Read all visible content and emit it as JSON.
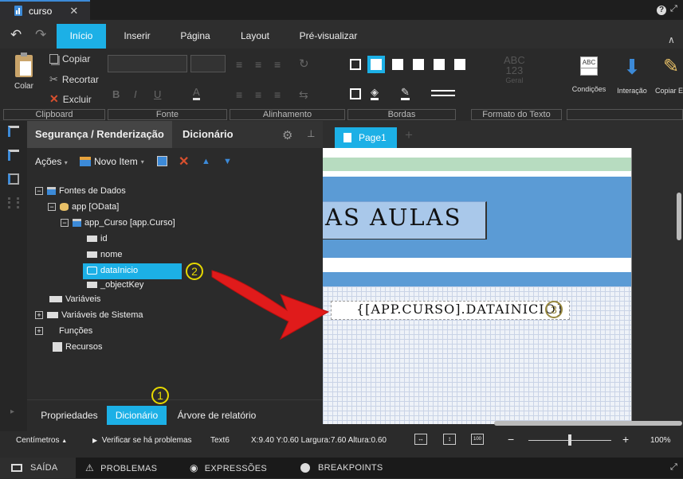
{
  "window": {
    "tab_title": "curso",
    "help_icon": "?"
  },
  "ribbon": {
    "tabs": [
      "Início",
      "Inserir",
      "Página",
      "Layout",
      "Pré-visualizar"
    ],
    "clipboard": {
      "paste": "Colar",
      "copy": "Copiar",
      "cut": "Recortar",
      "delete": "Excluir"
    },
    "format_preview": {
      "abc": "ABC",
      "n123": "123",
      "general": "Geral"
    },
    "buttons": {
      "conditions": "Condições",
      "interaction": "Interação",
      "copy_style": "Copiar E"
    },
    "groups": [
      "Clipboard",
      "Fonte",
      "Alinhamento",
      "Bordas",
      "Formato do Texto"
    ]
  },
  "panel": {
    "tabs": [
      "Segurança / Renderização",
      "Dicionário"
    ],
    "toolbar": {
      "actions": "Ações",
      "new_item": "Novo Item"
    },
    "tree": {
      "data_sources": "Fontes de Dados",
      "app": "app [OData]",
      "app_curso": "app_Curso [app.Curso]",
      "id": "id",
      "nome": "nome",
      "datainicio": "dataInicio",
      "objectkey": "_objectKey",
      "variables": "Variáveis",
      "system_variables": "Variáveis de Sistema",
      "functions": "Funções",
      "resources": "Recursos"
    },
    "bottom_tabs": [
      "Propriedades",
      "Dicionário",
      "Árvore de relatório"
    ]
  },
  "canvas": {
    "page_tab": "Page1",
    "add_tab": "+",
    "title_text": "AS AULAS",
    "field_expression": "{[APP.CURSO].DATAINICIO}"
  },
  "annotations": {
    "one": "1",
    "two": "2",
    "three": "3"
  },
  "status": {
    "units": "Centímetros",
    "check": "Verificar se há problemas",
    "component": "Text6",
    "position": "X:9.40 Y:0.60 Largura:7.60 Altura:0.60",
    "zoom": "100%",
    "zoom_minus": "−",
    "zoom_plus": "+",
    "zoom_level": 0.5
  },
  "bottom": {
    "output": "SAÍDA",
    "problems": "PROBLEMAS",
    "expressions": "EXPRESSÕES",
    "breakpoints": "BREAKPOINTS"
  },
  "colors": {
    "accent": "#1cb0e6",
    "header_blue": "#5b9bd5",
    "green_band": "#b7dcc0",
    "arrow_red": "#e01b1b",
    "badge_yellow": "#e6d900"
  }
}
